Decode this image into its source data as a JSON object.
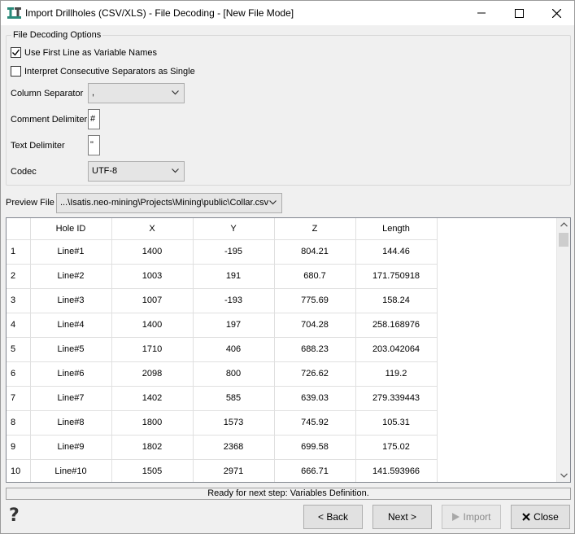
{
  "window": {
    "title": "Import Drillholes (CSV/XLS) - File Decoding - [New File Mode]",
    "controls": [
      "minimize-icon",
      "maximize-icon",
      "close-icon"
    ]
  },
  "options": {
    "group_title": "File Decoding Options",
    "use_first_line_label": "Use First Line as Variable Names",
    "use_first_line_checked": true,
    "consecutive_separators_label": "Interpret Consecutive Separators as Single",
    "consecutive_separators_checked": false,
    "column_separator_label": "Column Separator",
    "column_separator_value": ",",
    "comment_delimiter_label": "Comment Delimiter",
    "comment_delimiter_value": "#",
    "text_delimiter_label": "Text Delimiter",
    "text_delimiter_value": "\"",
    "codec_label": "Codec",
    "codec_value": "UTF-8"
  },
  "preview": {
    "label": "Preview File",
    "file_value": "...\\Isatis.neo-mining\\Projects\\Mining\\public\\Collar.csv"
  },
  "table": {
    "columns": [
      "Hole ID",
      "X",
      "Y",
      "Z",
      "Length"
    ],
    "rows": [
      {
        "num": "1",
        "cells": [
          "Line#1",
          "1400",
          "-195",
          "804.21",
          "144.46"
        ]
      },
      {
        "num": "2",
        "cells": [
          "Line#2",
          "1003",
          "191",
          "680.7",
          "171.750918"
        ]
      },
      {
        "num": "3",
        "cells": [
          "Line#3",
          "1007",
          "-193",
          "775.69",
          "158.24"
        ]
      },
      {
        "num": "4",
        "cells": [
          "Line#4",
          "1400",
          "197",
          "704.28",
          "258.168976"
        ]
      },
      {
        "num": "5",
        "cells": [
          "Line#5",
          "1710",
          "406",
          "688.23",
          "203.042064"
        ]
      },
      {
        "num": "6",
        "cells": [
          "Line#6",
          "2098",
          "800",
          "726.62",
          "119.2"
        ]
      },
      {
        "num": "7",
        "cells": [
          "Line#7",
          "1402",
          "585",
          "639.03",
          "279.339443"
        ]
      },
      {
        "num": "8",
        "cells": [
          "Line#8",
          "1800",
          "1573",
          "745.92",
          "105.31"
        ]
      },
      {
        "num": "9",
        "cells": [
          "Line#9",
          "1802",
          "2368",
          "699.58",
          "175.02"
        ]
      },
      {
        "num": "10",
        "cells": [
          "Line#10",
          "1505",
          "2971",
          "666.71",
          "141.593966"
        ]
      }
    ]
  },
  "status": "Ready for next step: Variables Definition.",
  "buttons": {
    "back": "< Back",
    "next": "Next >",
    "import": "Import",
    "close": "Close"
  },
  "colors": {
    "accent": "#2a8a7a",
    "window_bg": "#f0f0f0"
  }
}
